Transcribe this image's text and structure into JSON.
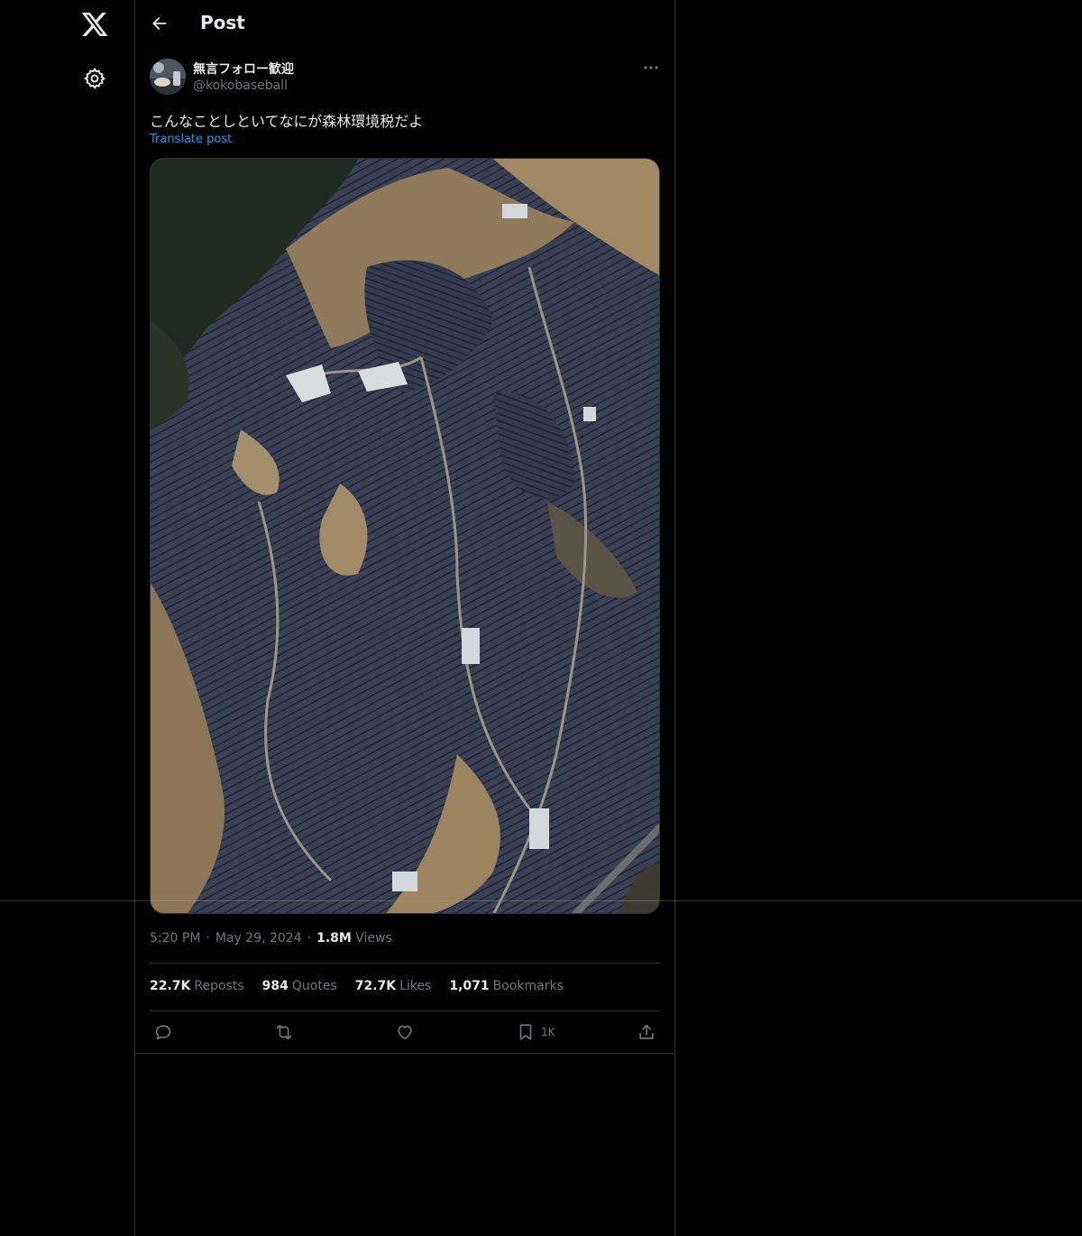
{
  "nav": {
    "logo_icon": "x-logo-icon",
    "settings_icon": "gear-icon"
  },
  "header": {
    "title": "Post"
  },
  "post": {
    "display_name": "無言フォロー歓迎",
    "handle": "@kokobaseball",
    "text": "こんなことしといてなにが森林環境税だよ",
    "translate_label": "Translate post",
    "media_alt": "Aerial photo of solar panels covering hillsides",
    "time": "5:20 PM",
    "date": "May 29, 2024",
    "views_count": "1.8M",
    "views_label": "Views"
  },
  "stats": {
    "reposts_count": "22.7K",
    "reposts_label": "Reposts",
    "quotes_count": "984",
    "quotes_label": "Quotes",
    "likes_count": "72.7K",
    "likes_label": "Likes",
    "bookmarks_count": "1,071",
    "bookmarks_label": "Bookmarks"
  },
  "actions": {
    "bookmark_count": "1K"
  },
  "colors": {
    "background": "#000000",
    "text": "#e7e9ea",
    "muted": "#71767b",
    "accent": "#1d9bf0",
    "border": "#2f3336"
  }
}
